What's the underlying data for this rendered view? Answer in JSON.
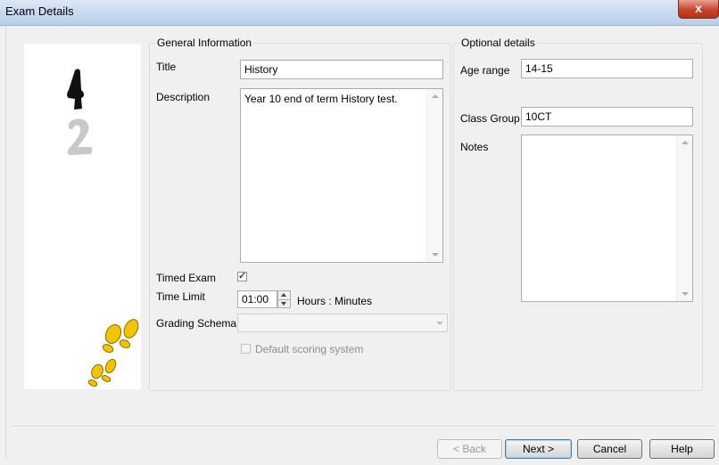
{
  "window": {
    "title": "Exam Details",
    "close_label": "x"
  },
  "general": {
    "legend": "General Information",
    "title_label": "Title",
    "title_value": "History",
    "description_label": "Description",
    "description_value": "Year 10 end of term History test.",
    "timed_label": "Timed Exam",
    "timed_checked": true,
    "time_limit_label": "Time Limit",
    "time_limit_value": "01:00",
    "time_units": "Hours : Minutes",
    "grading_label": "Grading Schema",
    "grading_value": "",
    "default_scoring_label": "Default scoring system"
  },
  "optional": {
    "legend": "Optional details",
    "age_label": "Age range",
    "age_value": "14-15",
    "class_label": "Class Group",
    "class_value": "10CT",
    "notes_label": "Notes",
    "notes_value": ""
  },
  "buttons": {
    "back": "< Back",
    "next": "Next >",
    "cancel": "Cancel",
    "help": "Help"
  },
  "side_panel": {
    "icons": [
      "step-1-icon",
      "step-2-icon",
      "footprints-icon"
    ]
  },
  "colors": {
    "footprint": "#f4c400",
    "step1": "#111111",
    "step2": "#c8c8c8"
  }
}
